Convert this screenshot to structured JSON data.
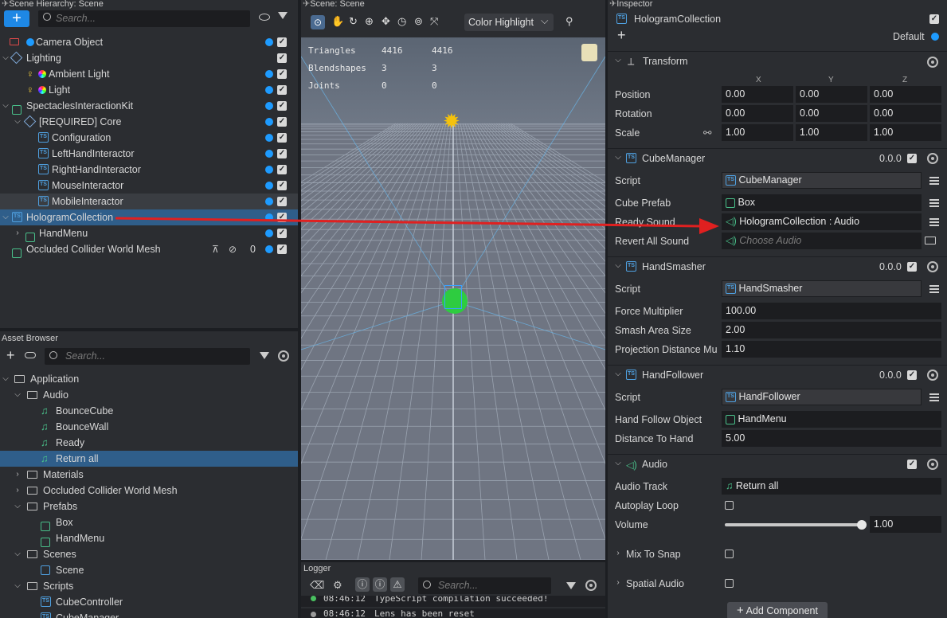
{
  "hierarchy": {
    "title": "Scene Hierarchy: Scene",
    "search_placeholder": "Search...",
    "items": [
      {
        "label": "Camera Object",
        "icon": "camera-icon"
      },
      {
        "label": "Lighting",
        "icon": "lighting-icon"
      },
      {
        "label": "Ambient Light",
        "icon": "bulb-icon"
      },
      {
        "label": "Light",
        "icon": "bulb-icon"
      },
      {
        "label": "SpectaclesInteractionKit",
        "icon": "object-icon"
      },
      {
        "label": "[REQUIRED] Core",
        "icon": "core-icon"
      },
      {
        "label": "Configuration",
        "icon": "ts-icon"
      },
      {
        "label": "LeftHandInteractor",
        "icon": "ts-icon"
      },
      {
        "label": "RightHandInteractor",
        "icon": "ts-icon"
      },
      {
        "label": "MouseInteractor",
        "icon": "ts-icon"
      },
      {
        "label": "MobileInteractor",
        "icon": "ts-icon"
      },
      {
        "label": "HologramCollection",
        "icon": "ts-icon"
      },
      {
        "label": "HandMenu",
        "icon": "object-icon"
      },
      {
        "label": "Occluded Collider World Mesh",
        "icon": "object-icon",
        "count": "0"
      }
    ]
  },
  "assets": {
    "title": "Asset Browser",
    "search_placeholder": "Search...",
    "items": [
      {
        "label": "Application"
      },
      {
        "label": "Audio"
      },
      {
        "label": "BounceCube"
      },
      {
        "label": "BounceWall"
      },
      {
        "label": "Ready"
      },
      {
        "label": "Return all"
      },
      {
        "label": "Materials"
      },
      {
        "label": "Occluded Collider World Mesh"
      },
      {
        "label": "Prefabs"
      },
      {
        "label": "Box"
      },
      {
        "label": "HandMenu"
      },
      {
        "label": "Scenes"
      },
      {
        "label": "Scene"
      },
      {
        "label": "Scripts"
      },
      {
        "label": "CubeController"
      },
      {
        "label": "CubeManager"
      }
    ]
  },
  "scene": {
    "title": "Scene: Scene",
    "highlight_mode": "Color Highlight",
    "stats": [
      {
        "name": "Triangles",
        "a": "4416",
        "b": "4416"
      },
      {
        "name": "Blendshapes",
        "a": "3",
        "b": "3"
      },
      {
        "name": "Joints",
        "a": "0",
        "b": "0"
      }
    ]
  },
  "logger": {
    "title": "Logger",
    "search_placeholder": "Search...",
    "lines": [
      {
        "time": "08:46:12",
        "text": "TypeScript compilation succeeded!"
      },
      {
        "time": "08:46:12",
        "text": "Lens has been reset"
      }
    ]
  },
  "inspector": {
    "title": "Inspector",
    "object_name": "HologramCollection",
    "layer": "Default",
    "transform": {
      "title": "Transform",
      "axes": [
        "X",
        "Y",
        "Z"
      ],
      "position_label": "Position",
      "rotation_label": "Rotation",
      "scale_label": "Scale",
      "position": [
        "0.00",
        "0.00",
        "0.00"
      ],
      "rotation": [
        "0.00",
        "0.00",
        "0.00"
      ],
      "scale": [
        "1.00",
        "1.00",
        "1.00"
      ]
    },
    "cube_manager": {
      "title": "CubeManager",
      "version": "0.0.0",
      "script_label": "Script",
      "script": "CubeManager",
      "prefab_label": "Cube Prefab",
      "prefab": "Box",
      "ready_label": "Ready Sound",
      "ready": "HologramCollection : Audio",
      "revert_label": "Revert All Sound",
      "revert_placeholder": "Choose Audio"
    },
    "hand_smasher": {
      "title": "HandSmasher",
      "version": "0.0.0",
      "script_label": "Script",
      "script": "HandSmasher",
      "force_label": "Force Multiplier",
      "force": "100.00",
      "area_label": "Smash Area Size",
      "area": "2.00",
      "proj_label": "Projection Distance Mul",
      "proj": "1.10"
    },
    "hand_follower": {
      "title": "HandFollower",
      "version": "0.0.0",
      "script_label": "Script",
      "script": "HandFollower",
      "follow_label": "Hand Follow Object",
      "follow": "HandMenu",
      "dist_label": "Distance To Hand",
      "dist": "5.00"
    },
    "audio": {
      "title": "Audio",
      "track_label": "Audio Track",
      "track": "Return all",
      "loop_label": "Autoplay Loop",
      "volume_label": "Volume",
      "volume": "1.00",
      "volume_level": 1.0,
      "mix_label": "Mix To Snap",
      "spatial_label": "Spatial Audio"
    },
    "add_component": "Add Component"
  },
  "colors": {
    "accent": "#1e9bff",
    "selection": "#2f5e8a",
    "arrow": "#e02020",
    "asset_green": "#49c08a"
  }
}
